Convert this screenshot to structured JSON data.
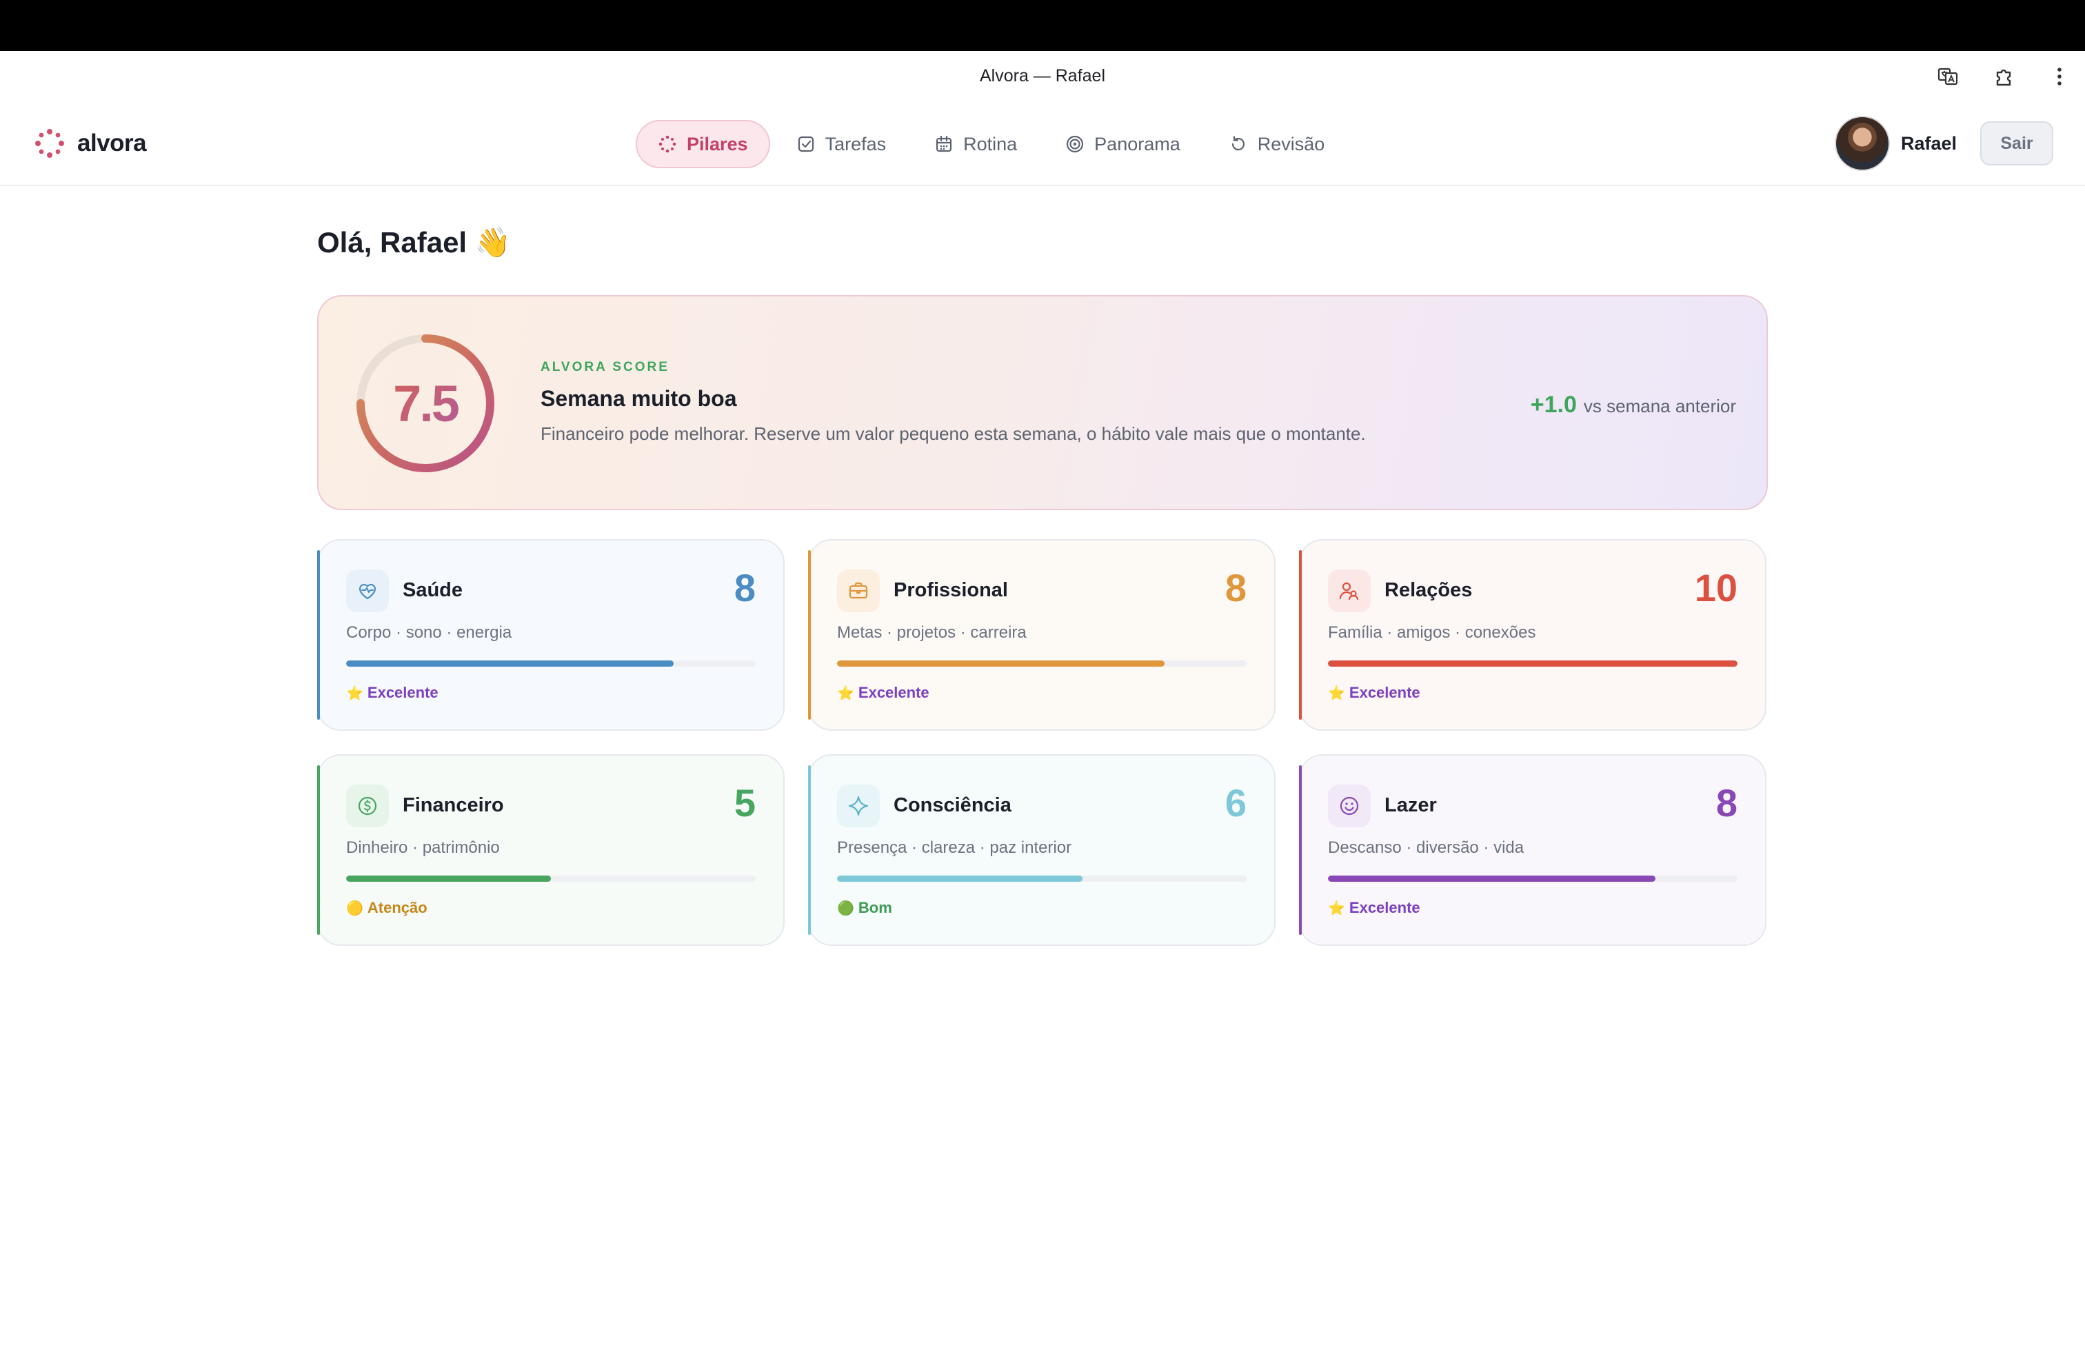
{
  "window": {
    "title": "Alvora — Rafael"
  },
  "brand": {
    "name": "alvora",
    "color": "#d0506e"
  },
  "nav": {
    "tabs": [
      {
        "label": "Pilares",
        "icon": "dots-grid-icon",
        "active": true
      },
      {
        "label": "Tarefas",
        "icon": "checkbox-icon",
        "active": false
      },
      {
        "label": "Rotina",
        "icon": "calendar-icon",
        "active": false
      },
      {
        "label": "Panorama",
        "icon": "target-icon",
        "active": false
      },
      {
        "label": "Revisão",
        "icon": "rotate-icon",
        "active": false
      }
    ]
  },
  "user": {
    "name": "Rafael",
    "logout_label": "Sair"
  },
  "greeting": {
    "text": "Olá, Rafael 👋"
  },
  "score": {
    "value": "7.5",
    "fraction": 0.75,
    "label": "ALVORA SCORE",
    "headline": "Semana muito boa",
    "description": "Financeiro pode melhorar. Reserve um valor pequeno esta semana, o hábito vale mais que o montante.",
    "delta": "+1.0",
    "delta_text": "vs semana anterior"
  },
  "pillars": [
    {
      "name": "Saúde",
      "score": "8",
      "progress": 0.8,
      "subtitle": "Corpo · sono · energia",
      "status": "Excelente",
      "status_emoji": "⭐",
      "status_color": "#7b3fc0",
      "color": "#4a8cc3",
      "bg": "#f6f9fd",
      "icon_bg": "#e8f0f9",
      "icon": "heart-pulse-icon"
    },
    {
      "name": "Profissional",
      "score": "8",
      "progress": 0.8,
      "subtitle": "Metas · projetos · carreira",
      "status": "Excelente",
      "status_emoji": "⭐",
      "status_color": "#7b3fc0",
      "color": "#e0963a",
      "bg": "#fdf9f5",
      "icon_bg": "#fcefe0",
      "icon": "briefcase-icon"
    },
    {
      "name": "Relações",
      "score": "10",
      "progress": 1.0,
      "subtitle": "Família · amigos · conexões",
      "status": "Excelente",
      "status_emoji": "⭐",
      "status_color": "#7b3fc0",
      "color": "#dc5040",
      "bg": "#fdf7f6",
      "icon_bg": "#fbe8e6",
      "icon": "users-icon"
    },
    {
      "name": "Financeiro",
      "score": "5",
      "progress": 0.5,
      "subtitle": "Dinheiro · patrimônio",
      "status": "Atenção",
      "status_emoji": "🟡",
      "status_color": "#c8861a",
      "color": "#49a660",
      "bg": "#f6fbf7",
      "icon_bg": "#e6f4ea",
      "icon": "dollar-circle-icon"
    },
    {
      "name": "Consciência",
      "score": "6",
      "progress": 0.6,
      "subtitle": "Presença · clareza · paz interior",
      "status": "Bom",
      "status_emoji": "🟢",
      "status_color": "#3e9b54",
      "color": "#7cc8d8",
      "bg": "#f6fbfc",
      "icon_bg": "#e7f5f8",
      "icon": "sparkle-icon"
    },
    {
      "name": "Lazer",
      "score": "8",
      "progress": 0.8,
      "subtitle": "Descanso · diversão · vida",
      "status": "Excelente",
      "status_emoji": "⭐",
      "status_color": "#7b3fc0",
      "color": "#8a48b6",
      "bg": "#faf7fc",
      "icon_bg": "#f1e8f8",
      "icon": "smile-icon"
    }
  ]
}
